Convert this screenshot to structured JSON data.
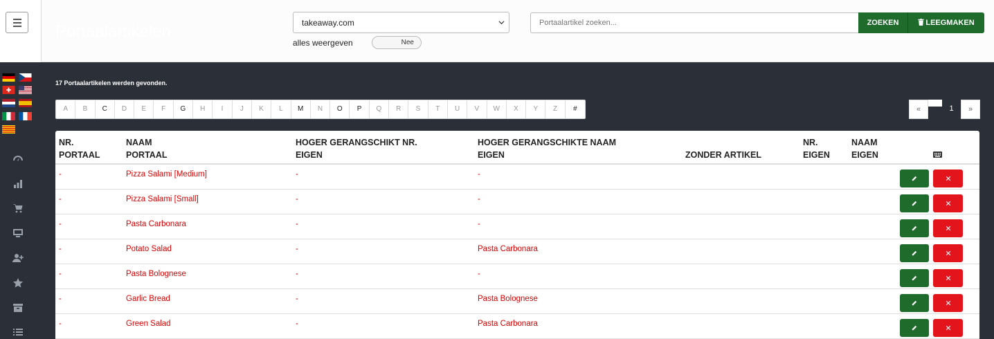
{
  "header": {
    "page_title": "Portaalartikelen",
    "portal_select": {
      "value": "takeaway.com"
    },
    "show_all": {
      "label": "alles weergeven",
      "toggle_text": "Nee"
    },
    "search": {
      "placeholder": "Portaalartikel zoeken...",
      "search_label": "ZOEKEN",
      "clear_label": "LEEGMAKEN"
    }
  },
  "sidebar": {
    "flags": [
      "de-flag-icon",
      "cz-flag-icon",
      "ch-flag-icon",
      "us-flag-icon",
      "nl-flag-icon",
      "es-flag-icon",
      "it-flag-icon",
      "fr-flag-icon",
      "catalonia-flag-icon"
    ],
    "nav": [
      "dashboard-icon",
      "bar-chart-icon",
      "cart-icon",
      "monitor-icon",
      "add-user-icon",
      "star-icon",
      "archive-icon",
      "list-icon"
    ]
  },
  "main": {
    "result_count": "17 Portaalartikelen werden gevonden.",
    "alphabet": [
      {
        "l": "A",
        "on": false
      },
      {
        "l": "B",
        "on": false
      },
      {
        "l": "C",
        "on": true
      },
      {
        "l": "D",
        "on": false
      },
      {
        "l": "E",
        "on": false
      },
      {
        "l": "F",
        "on": false
      },
      {
        "l": "G",
        "on": true
      },
      {
        "l": "H",
        "on": false
      },
      {
        "l": "I",
        "on": false
      },
      {
        "l": "J",
        "on": false
      },
      {
        "l": "K",
        "on": false
      },
      {
        "l": "L",
        "on": false
      },
      {
        "l": "M",
        "on": true
      },
      {
        "l": "N",
        "on": false
      },
      {
        "l": "O",
        "on": true
      },
      {
        "l": "P",
        "on": true
      },
      {
        "l": "Q",
        "on": false
      },
      {
        "l": "R",
        "on": false
      },
      {
        "l": "S",
        "on": false
      },
      {
        "l": "T",
        "on": false
      },
      {
        "l": "U",
        "on": false
      },
      {
        "l": "V",
        "on": false
      },
      {
        "l": "W",
        "on": false
      },
      {
        "l": "X",
        "on": false
      },
      {
        "l": "Y",
        "on": false
      },
      {
        "l": "Z",
        "on": false
      },
      {
        "l": "#",
        "on": true
      }
    ],
    "pager": {
      "prev": "«",
      "current": "1",
      "next": "»"
    },
    "table": {
      "headers": {
        "nr_portaal": [
          "NR.",
          "PORTAAL"
        ],
        "naam_portaal": [
          "NAAM",
          "PORTAAL"
        ],
        "hoger_nr": [
          "HOGER GERANGSCHIKT NR.",
          "EIGEN"
        ],
        "hoger_naam": [
          "HOGER GERANGSCHIKTE NAAM",
          "EIGEN"
        ],
        "zonder": [
          "ZONDER ARTIKEL",
          ""
        ],
        "nr_eigen": [
          "NR.",
          "EIGEN"
        ],
        "naam_eigen": [
          "NAAM",
          "EIGEN"
        ]
      },
      "rows": [
        {
          "nr": "-",
          "naam": "Pizza Salami [Medium]",
          "hnr": "-",
          "hnaam": "-"
        },
        {
          "nr": "-",
          "naam": "Pizza Salami [Small]",
          "hnr": "-",
          "hnaam": "-"
        },
        {
          "nr": "-",
          "naam": "Pasta Carbonara",
          "hnr": "-",
          "hnaam": "-"
        },
        {
          "nr": "-",
          "naam": "Potato Salad",
          "hnr": "-",
          "hnaam": "Pasta Carbonara"
        },
        {
          "nr": "-",
          "naam": "Pasta Bolognese",
          "hnr": "-",
          "hnaam": "-"
        },
        {
          "nr": "-",
          "naam": "Garlic Bread",
          "hnr": "-",
          "hnaam": "Pasta Bolognese"
        },
        {
          "nr": "-",
          "naam": "Green Salad",
          "hnr": "-",
          "hnaam": "Pasta Carbonara"
        }
      ]
    }
  }
}
